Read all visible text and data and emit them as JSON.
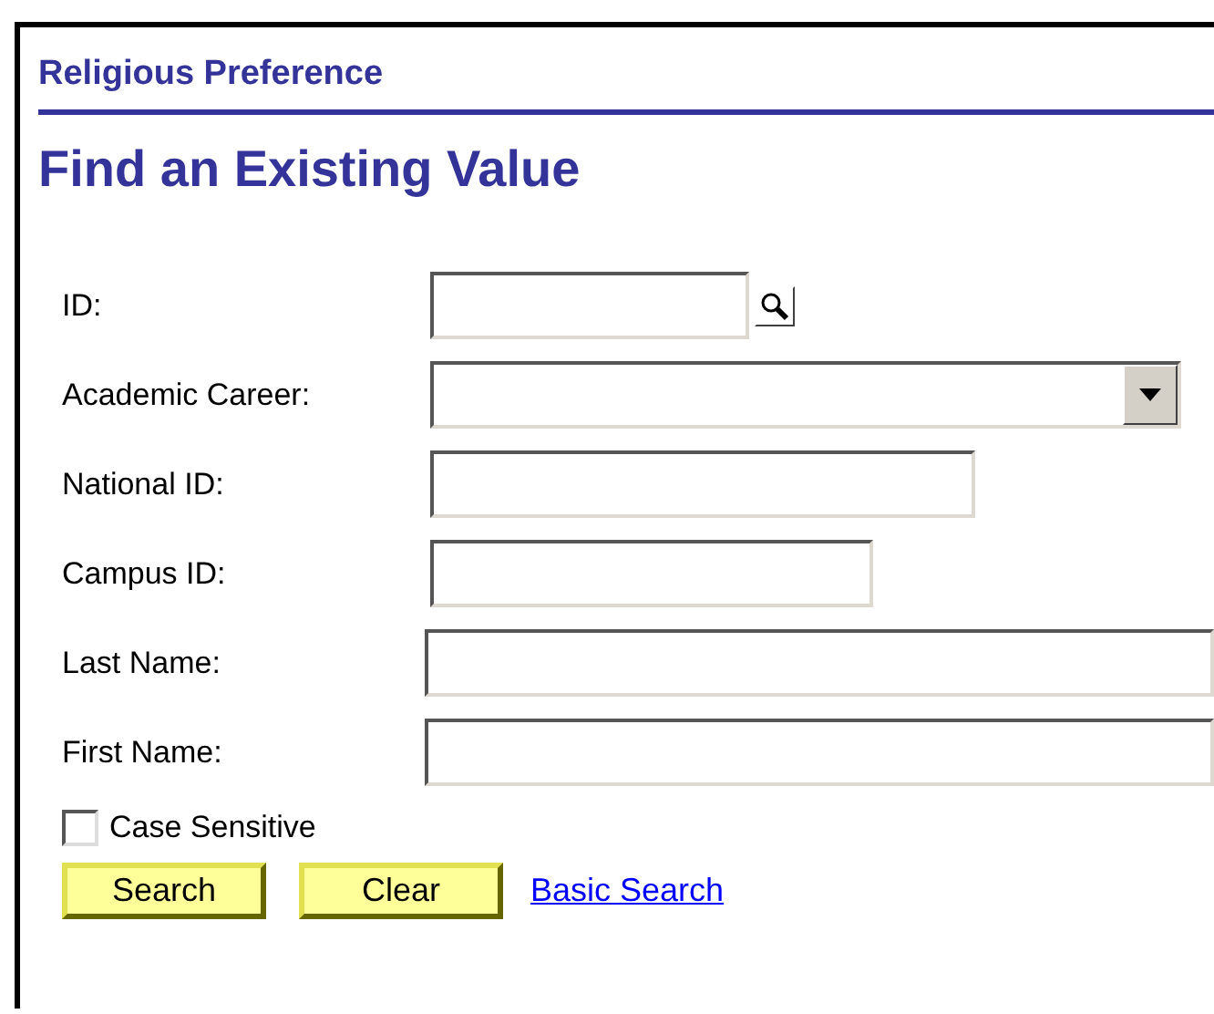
{
  "page_title": "Religious Preference",
  "heading": "Find an Existing Value",
  "fields": [
    {
      "label": "ID:",
      "kind": "lookup"
    },
    {
      "label": "Academic Career:",
      "kind": "dropdown"
    },
    {
      "label": "National ID:",
      "kind": "text"
    },
    {
      "label": "Campus ID:",
      "kind": "text"
    },
    {
      "label": "Last Name:",
      "kind": "text"
    },
    {
      "label": "First Name:",
      "kind": "text"
    }
  ],
  "case_sensitive": {
    "label": "Case Sensitive",
    "checked": false
  },
  "buttons": [
    "Search",
    "Clear"
  ],
  "link": "Basic Search"
}
